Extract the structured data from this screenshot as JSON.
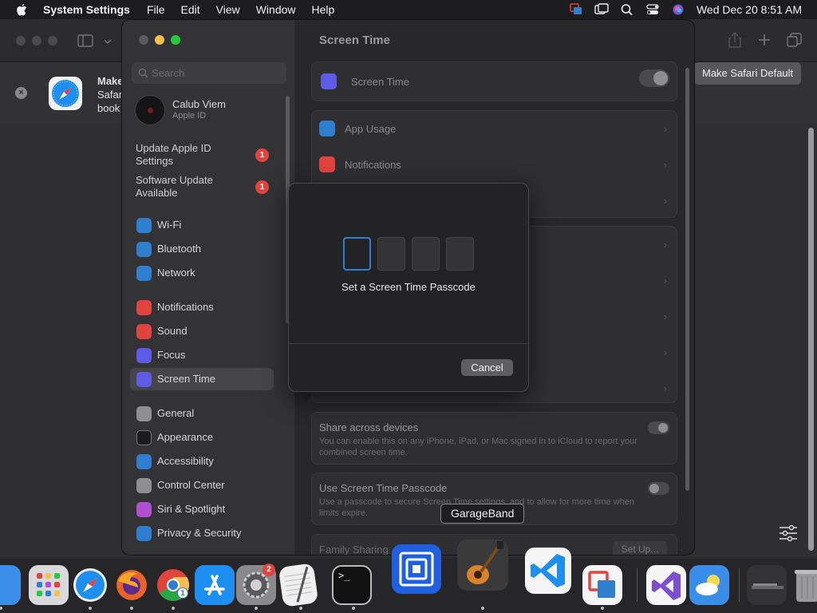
{
  "menubar": {
    "app_name": "System Settings",
    "menus": [
      "File",
      "Edit",
      "View",
      "Window",
      "Help"
    ],
    "clock": "Wed Dec 20  8:51 AM"
  },
  "safari": {
    "banner_title": "Make",
    "banner_line2": "Safar",
    "banner_line3": "book",
    "banner_close": "×",
    "make_default_button": "Make Safari Default"
  },
  "sidebar": {
    "search_placeholder": "Search",
    "profile_name": "Calub Viem",
    "profile_sub": "Apple ID",
    "notices": [
      {
        "label": "Update Apple ID Settings",
        "badge": "1"
      },
      {
        "label": "Software Update Available",
        "badge": "1"
      }
    ],
    "items": [
      {
        "label": "Wi-Fi",
        "icon": "wifi-icon",
        "color": "#2f7ecf"
      },
      {
        "label": "Bluetooth",
        "icon": "bluetooth-icon",
        "color": "#2f7ecf"
      },
      {
        "label": "Network",
        "icon": "globe-icon",
        "color": "#2f7ecf"
      },
      {
        "label": "Notifications",
        "icon": "bell-icon",
        "color": "#e0443e"
      },
      {
        "label": "Sound",
        "icon": "speaker-icon",
        "color": "#e0443e"
      },
      {
        "label": "Focus",
        "icon": "moon-icon",
        "color": "#5e5ce6"
      },
      {
        "label": "Screen Time",
        "icon": "hourglass-icon",
        "color": "#5e5ce6"
      },
      {
        "label": "General",
        "icon": "gear-icon",
        "color": "#8e8e93"
      },
      {
        "label": "Appearance",
        "icon": "appearance-icon",
        "color": "#1c1c1e"
      },
      {
        "label": "Accessibility",
        "icon": "accessibility-icon",
        "color": "#2f7ecf"
      },
      {
        "label": "Control Center",
        "icon": "control-center-icon",
        "color": "#8e8e93"
      },
      {
        "label": "Siri & Spotlight",
        "icon": "siri-icon",
        "color": "#b04fd0"
      },
      {
        "label": "Privacy & Security",
        "icon": "hand-icon",
        "color": "#2f7ecf"
      }
    ],
    "active": "Screen Time"
  },
  "content": {
    "title": "Screen Time",
    "screen_time_row": "Screen Time",
    "app_usage": "App Usage",
    "notifications": "Notifications",
    "share_title": "Share across devices",
    "share_desc": "You can enable this on any iPhone, iPad, or Mac signed in to iCloud to report your combined screen time.",
    "passcode_title": "Use Screen Time Passcode",
    "passcode_desc": "Use a passcode to secure Screen Time settings, and to allow for more time when limits expire.",
    "family_title": "Family Sharing",
    "setup_button": "Set Up..."
  },
  "dialog": {
    "title": "Set a Screen Time Passcode",
    "cancel": "Cancel",
    "digits": [
      "",
      "",
      "",
      ""
    ]
  },
  "tooltip": "GarageBand",
  "dock": {
    "apps": [
      {
        "name": "Finder",
        "color": "#3b8fe8"
      },
      {
        "name": "Launchpad",
        "color": "#d9d9dc"
      },
      {
        "name": "Safari",
        "color": "#f2f2f2"
      },
      {
        "name": "Firefox",
        "color": "#e8632b"
      },
      {
        "name": "Chrome",
        "color": "#f2f2f2"
      },
      {
        "name": "App Store",
        "color": "#1e8ef0"
      },
      {
        "name": "System Settings",
        "color": "#8a8a8e"
      },
      {
        "name": "TextEdit",
        "color": "#efefef"
      },
      {
        "name": "Terminal",
        "color": "#111111"
      },
      {
        "name": "Screens",
        "color": "#1f5fe0"
      },
      {
        "name": "GarageBand",
        "color": "#3a3a3a"
      },
      {
        "name": "Visual Studio Code",
        "color": "#f5f5f5"
      },
      {
        "name": "Remote Desktop",
        "color": "#f5f5f5"
      },
      {
        "name": "Visual Studio",
        "color": "#f5f5f5"
      },
      {
        "name": "Weather",
        "color": "#3b8ee8"
      },
      {
        "name": "Downloads",
        "color": "#333335"
      },
      {
        "name": "Trash",
        "color": "#9a9a9c"
      }
    ],
    "settings_badge": "2",
    "chrome_badge": "1",
    "terminal_prompt": ">_"
  }
}
